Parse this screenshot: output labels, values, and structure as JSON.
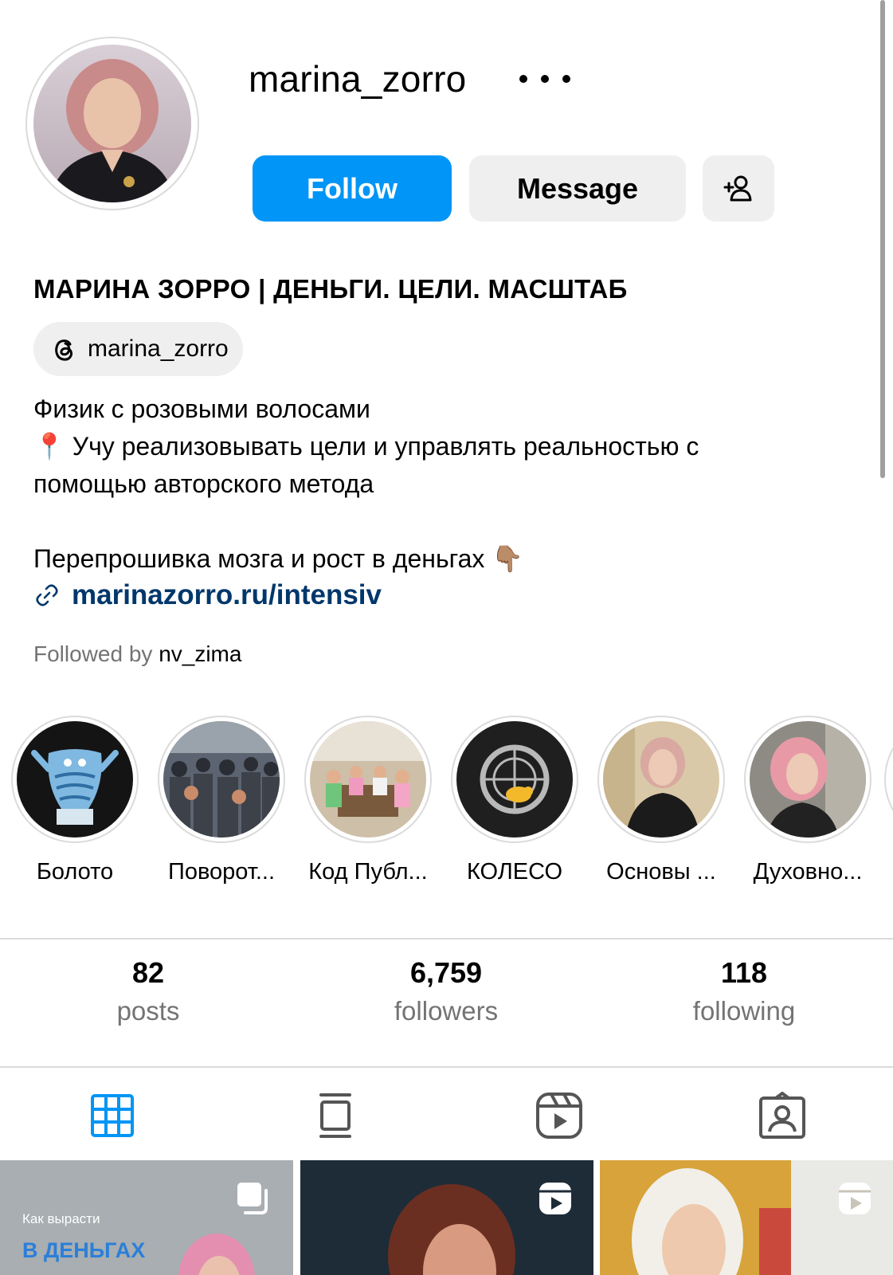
{
  "profile": {
    "username": "marina_zorro",
    "full_name": "МАРИНА ЗОРРО | ДЕНЬГИ. ЦЕЛИ. МАСШТАБ",
    "threads_handle": "marina_zorro",
    "bio_lines": [
      "Физик с розовыми волосами",
      "📍 Учу реализовывать цели и управлять реальностью с",
      "помощью авторского метода",
      "",
      "Перепрошивка мозга и рост в деньгах 👇🏽"
    ],
    "link": "marinazorro.ru/intensiv",
    "followed_by_prefix": "Followed by",
    "followed_by_user": "nv_zima"
  },
  "actions": {
    "follow": "Follow",
    "message": "Message"
  },
  "highlights": [
    {
      "label": "Болото",
      "icon": "fish-figure"
    },
    {
      "label": "Поворот...",
      "icon": "crowd-photo"
    },
    {
      "label": "Код Публ...",
      "icon": "group-dinner-photo"
    },
    {
      "label": "КОЛЕСО",
      "icon": "hamster-wheel"
    },
    {
      "label": "Основы ...",
      "icon": "portrait-photo"
    },
    {
      "label": "Духовно...",
      "icon": "portrait-photo"
    }
  ],
  "stats": {
    "posts": {
      "value": "82",
      "label": "posts"
    },
    "followers": {
      "value": "6,759",
      "label": "followers"
    },
    "following": {
      "value": "118",
      "label": "following"
    }
  },
  "tabs": [
    {
      "name": "posts-grid",
      "icon": "grid-icon",
      "active": true
    },
    {
      "name": "feed",
      "icon": "feed-icon",
      "active": false
    },
    {
      "name": "reels",
      "icon": "reels-icon",
      "active": false
    },
    {
      "name": "tagged",
      "icon": "tagged-icon",
      "active": false
    }
  ],
  "grid_posts": [
    {
      "caption_small": "Как вырасти",
      "caption_big": "В ДЕНЬГАХ",
      "badge": "carousel-icon"
    },
    {
      "caption_small": "",
      "caption_big": "",
      "badge": "reels-icon"
    },
    {
      "caption_small": "",
      "caption_big": "",
      "badge": "reels-icon"
    }
  ],
  "colors": {
    "accent": "#0095f6",
    "link": "#00376b",
    "secondary_text": "#737373",
    "button_gray": "#efefef"
  }
}
